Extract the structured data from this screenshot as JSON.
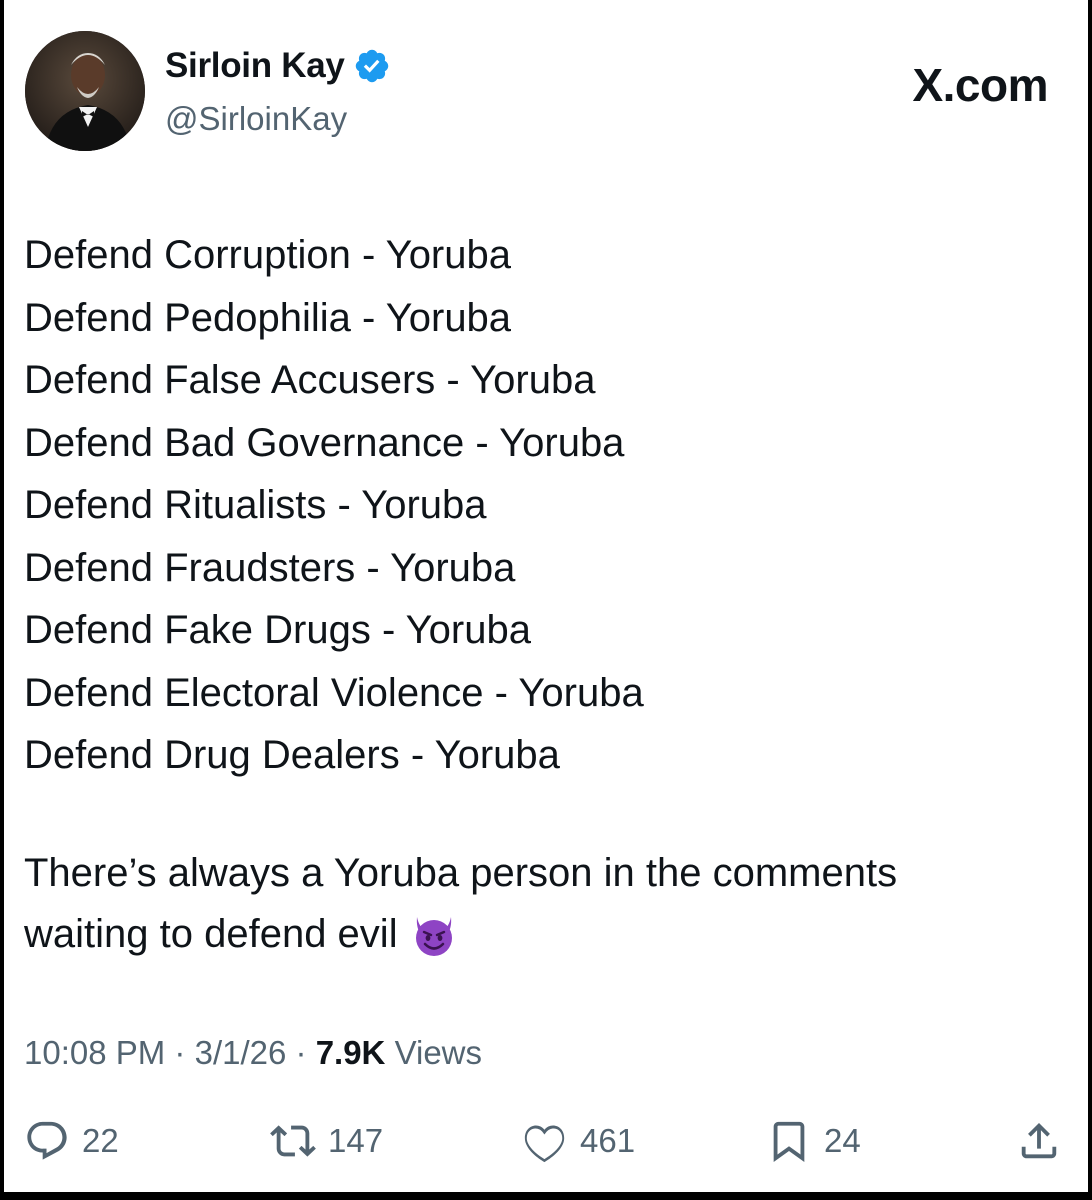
{
  "author": {
    "name": "Sirloin Kay",
    "handle": "@SirloinKay",
    "verified_icon": "verified-badge-icon",
    "avatar": "avatar-photo"
  },
  "site": "X.com",
  "tweet": {
    "lines": [
      "Defend Corruption - Yoruba",
      "Defend Pedophilia - Yoruba",
      "Defend False Accusers - Yoruba",
      "Defend Bad Governance - Yoruba",
      "Defend Ritualists - Yoruba",
      "Defend Fraudsters - Yoruba",
      "Defend Fake Drugs - Yoruba",
      "Defend Electoral Violence - Yoruba",
      "Defend Drug Dealers - Yoruba"
    ],
    "closing_line1": "There’s always a Yoruba person in the comments",
    "closing_line2": "waiting to defend evil",
    "closing_emoji": "smiling-devil-emoji"
  },
  "meta": {
    "time": "10:08 PM",
    "separator": "·",
    "date": "3/1/26",
    "views_count": "7.9K",
    "views_label": "Views"
  },
  "actions": {
    "replies": "22",
    "reposts": "147",
    "likes": "461",
    "bookmarks": "24"
  },
  "colors": {
    "text": "#0f1419",
    "muted": "#536471",
    "verified": "#1d9bf0",
    "emoji": "#8e44c4"
  }
}
